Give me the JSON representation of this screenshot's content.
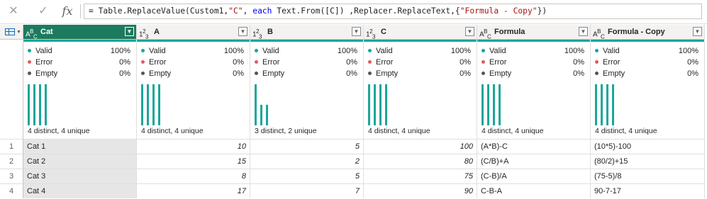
{
  "formula_bar": {
    "cancel_icon": "close-x",
    "commit_icon": "checkmark",
    "fx_label": "fx",
    "expr_prefix": "= Table.ReplaceValue(Custom1,",
    "expr_str1": "\"C\"",
    "expr_mid1": ", ",
    "expr_kw": "each",
    "expr_mid2": " Text.From([C]) ,Replacer.ReplaceText,{",
    "expr_str2": "\"Formula - Copy\"",
    "expr_suffix": "})"
  },
  "colors": {
    "accent": "#1c7a5f",
    "quality_bar": "#1aa699",
    "valid": "#1aa699",
    "error": "#e05c5c",
    "empty": "#555555"
  },
  "columns": [
    {
      "type_top": "A",
      "type_sup": "B",
      "type_sub": "C",
      "name": "Cat",
      "valid": "100%",
      "error": "0%",
      "empty": "0%",
      "distinct": "4 distinct, 4 unique",
      "bars": [
        1,
        1,
        1,
        1
      ]
    },
    {
      "type_top": "1",
      "type_sup": "2",
      "type_sub": "3",
      "name": "A",
      "valid": "100%",
      "error": "0%",
      "empty": "0%",
      "distinct": "4 distinct, 4 unique",
      "bars": [
        1,
        1,
        1,
        1
      ]
    },
    {
      "type_top": "1",
      "type_sup": "2",
      "type_sub": "3",
      "name": "B",
      "valid": "100%",
      "error": "0%",
      "empty": "0%",
      "distinct": "3 distinct, 2 unique",
      "bars": [
        1,
        0.5,
        0.5
      ]
    },
    {
      "type_top": "1",
      "type_sup": "2",
      "type_sub": "3",
      "name": "C",
      "valid": "100%",
      "error": "0%",
      "empty": "0%",
      "distinct": "4 distinct, 4 unique",
      "bars": [
        1,
        1,
        1,
        1
      ]
    },
    {
      "type_top": "A",
      "type_sup": "B",
      "type_sub": "C",
      "name": "Formula",
      "valid": "100%",
      "error": "0%",
      "empty": "0%",
      "distinct": "4 distinct, 4 unique",
      "bars": [
        1,
        1,
        1,
        1
      ]
    },
    {
      "type_top": "A",
      "type_sup": "B",
      "type_sub": "C",
      "name": "Formula - Copy",
      "valid": "100%",
      "error": "0%",
      "empty": "0%",
      "distinct": "4 distinct, 4 unique",
      "bars": [
        1,
        1,
        1,
        1
      ]
    }
  ],
  "quality_labels": {
    "valid": "Valid",
    "error": "Error",
    "empty": "Empty"
  },
  "rows": [
    {
      "n": "1",
      "cells": [
        "Cat 1",
        "10",
        "5",
        "100",
        "(A*B)-C",
        "(10*5)-100"
      ]
    },
    {
      "n": "2",
      "cells": [
        "Cat 2",
        "15",
        "2",
        "80",
        "(C/B)+A",
        "(80/2)+15"
      ]
    },
    {
      "n": "3",
      "cells": [
        "Cat 3",
        "8",
        "5",
        "75",
        "(C-B)/A",
        "(75-5)/8"
      ]
    },
    {
      "n": "4",
      "cells": [
        "Cat 4",
        "17",
        "7",
        "90",
        "C-B-A",
        "90-7-17"
      ]
    }
  ]
}
